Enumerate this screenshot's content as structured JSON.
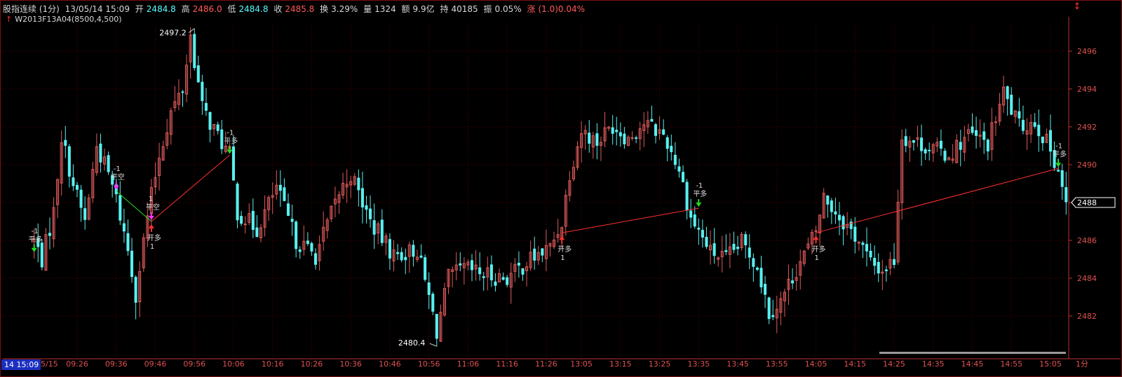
{
  "header": {
    "title": "股指连续 (1分)",
    "datetime": "13/05/14 15:09",
    "open_label": "开",
    "open_value": "2484.8",
    "high_label": "高",
    "high_value": "2486.0",
    "low_label": "低",
    "low_value": "2484.8",
    "close_label": "收",
    "close_value": "2485.8",
    "turnover_label": "换",
    "turnover_value": "3.29%",
    "volume_label": "量",
    "volume_value": "1324",
    "amount_label": "额",
    "amount_value": "9.9亿",
    "oi_label": "持",
    "oi_value": "40185",
    "amp_label": "振",
    "amp_value": "0.05%",
    "chg_label": "涨",
    "chg_value": "(1.0)0.04%"
  },
  "indicator": {
    "arrow": "↑",
    "name": "W2013F13A04(8500,4,500)"
  },
  "settings_icon": "↕",
  "colors": {
    "up": "#ff5a5a",
    "down": "#5ff",
    "grid": "#5a0000",
    "axis": "#c03030",
    "signal_up": "#ff3030",
    "signal_down": "#22dd22",
    "short_open": "#ff33ff"
  },
  "chart_data": {
    "type": "candlestick",
    "ylim": [
      2480.4,
      2497.2
    ],
    "y_ticks": [
      "2496",
      "2494",
      "2492",
      "2490",
      "2488",
      "2486",
      "2484",
      "2482"
    ],
    "x_ticks": [
      "09:26",
      "09:36",
      "09:46",
      "09:56",
      "10:06",
      "10:16",
      "10:26",
      "10:36",
      "10:46",
      "10:56",
      "11:06",
      "11:16",
      "11:26",
      "13:05",
      "13:15",
      "13:25",
      "13:35",
      "13:45",
      "13:55",
      "14:05",
      "14:15",
      "14:25",
      "14:35",
      "14:45",
      "14:55",
      "15:05"
    ],
    "x_first_partial": "5/15",
    "x_last_partial": "1分",
    "current_time": "14 15:09",
    "last_price": "2488",
    "max_annotation": "2497.2",
    "min_annotation": "2480.4",
    "signals": [
      {
        "time": "09:15",
        "price": 2485.3,
        "type": "平多",
        "qty": "-1"
      },
      {
        "time": "09:36",
        "price": 2488.6,
        "type": "平空",
        "qty": "-1"
      },
      {
        "time": "09:45",
        "price": 2487.0,
        "type": "平空",
        "qty": "1"
      },
      {
        "time": "09:45",
        "price": 2487.0,
        "type": "开多",
        "qty": "1"
      },
      {
        "time": "10:05",
        "price": 2490.5,
        "type": "平多",
        "qty": "-1"
      },
      {
        "time": "11:30",
        "price": 2486.4,
        "type": "开多",
        "qty": "1"
      },
      {
        "time": "13:35",
        "price": 2487.7,
        "type": "平多",
        "qty": "-1"
      },
      {
        "time": "14:05",
        "price": 2486.4,
        "type": "开多",
        "qty": "1"
      },
      {
        "time": "15:07",
        "price": 2489.8,
        "type": "平多",
        "qty": "-1"
      }
    ]
  }
}
